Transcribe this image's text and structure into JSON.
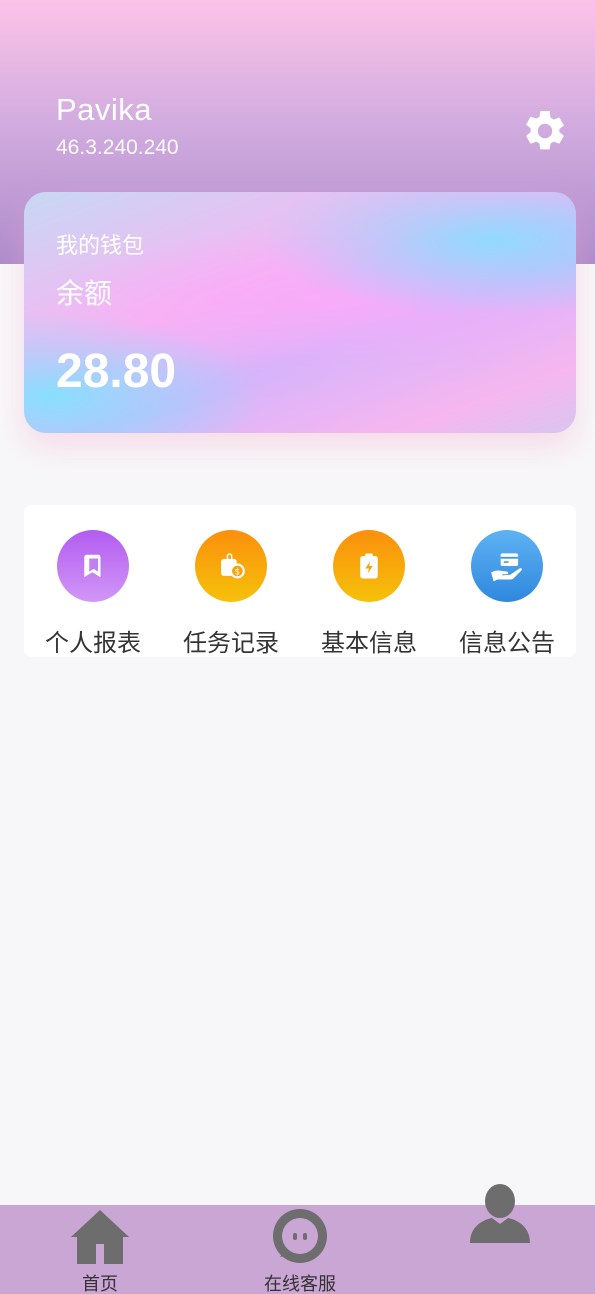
{
  "user": {
    "name": "Pavika",
    "ip": "46.3.240.240"
  },
  "wallet": {
    "title": "我的钱包",
    "balance_label": "余额",
    "balance_value": "28.80"
  },
  "menu": [
    {
      "label": "个人报表",
      "icon": "bookmark-icon",
      "color": "#b77cf0"
    },
    {
      "label": "任务记录",
      "icon": "shopping-bag-coin-icon",
      "color": "#f8a10a"
    },
    {
      "label": "基本信息",
      "icon": "clipboard-lightning-icon",
      "color": "#f8a10a"
    },
    {
      "label": "信息公告",
      "icon": "card-hand-icon",
      "color": "#3f9ae4"
    }
  ],
  "tabbar": {
    "items": [
      {
        "label": "首页",
        "icon": "home-icon"
      },
      {
        "label": "在线客服",
        "icon": "chat-icon"
      },
      {
        "label": "",
        "icon": "user-icon"
      }
    ]
  },
  "colors": {
    "header_top": "#fcc3e8",
    "header_bottom": "#ae8ccb",
    "tabbar_bg": "#c9a6d3",
    "icon_gray": "#6d6d6d"
  }
}
